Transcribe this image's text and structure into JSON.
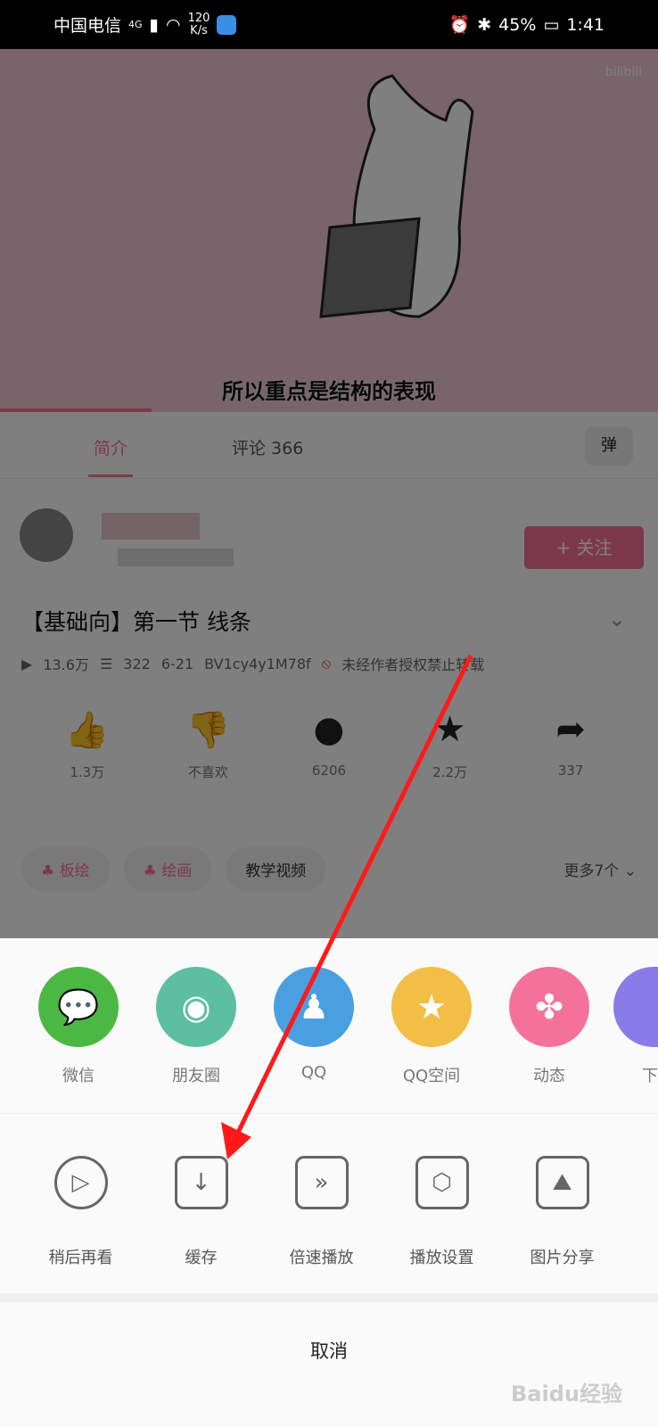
{
  "status_bar": {
    "carrier": "中国电信",
    "network": "4G",
    "speed_value": "120",
    "speed_unit": "K/s",
    "battery_small": "45%",
    "time": "1:41"
  },
  "video": {
    "subtitle": "所以重点是结构的表现",
    "watermark": "bilibili",
    "progress_percent": 23,
    "background": "#f0c8d4"
  },
  "tabs": {
    "intro": "简介",
    "comments": "评论 366",
    "danmaku_icon": "弹"
  },
  "uploader": {
    "follow_label": "+ 关注"
  },
  "video_info": {
    "title": "【基础向】第一节 线条",
    "views": "13.6万",
    "danmaku_count": "322",
    "date": "6-21",
    "bvid": "BV1cy4y1M78f",
    "copyright": "未经作者授权禁止转载"
  },
  "actions": [
    {
      "icon": "thumbs-up",
      "label": "1.3万"
    },
    {
      "icon": "thumbs-down",
      "label": "不喜欢"
    },
    {
      "icon": "coin",
      "label": "6206"
    },
    {
      "icon": "star",
      "label": "2.2万"
    },
    {
      "icon": "share",
      "label": "337"
    }
  ],
  "tags": {
    "items": [
      "板绘",
      "绘画",
      "教学视频"
    ],
    "more": "更多7个"
  },
  "share_sheet": {
    "targets": [
      {
        "label": "微信",
        "color": "#4cb844",
        "glyph": "💬"
      },
      {
        "label": "朋友圈",
        "color": "#5bbfa0",
        "glyph": "◉"
      },
      {
        "label": "QQ",
        "color": "#4a9fe0",
        "glyph": "♟"
      },
      {
        "label": "QQ空间",
        "color": "#f2be45",
        "glyph": "★"
      },
      {
        "label": "动态",
        "color": "#f47299",
        "glyph": "✤"
      },
      {
        "label": "下",
        "color": "#8a7ce8",
        "glyph": ""
      }
    ],
    "tools": [
      {
        "label": "稍后再看",
        "glyph": "▷"
      },
      {
        "label": "缓存",
        "glyph": "↓"
      },
      {
        "label": "倍速播放",
        "glyph": "»"
      },
      {
        "label": "播放设置",
        "glyph": "⬡"
      },
      {
        "label": "图片分享",
        "glyph": "⛰"
      }
    ],
    "cancel": "取消"
  },
  "watermark": "Baidu经验",
  "colors": {
    "accent": "#fb7299",
    "annotation_arrow": "#ff1a1a"
  }
}
